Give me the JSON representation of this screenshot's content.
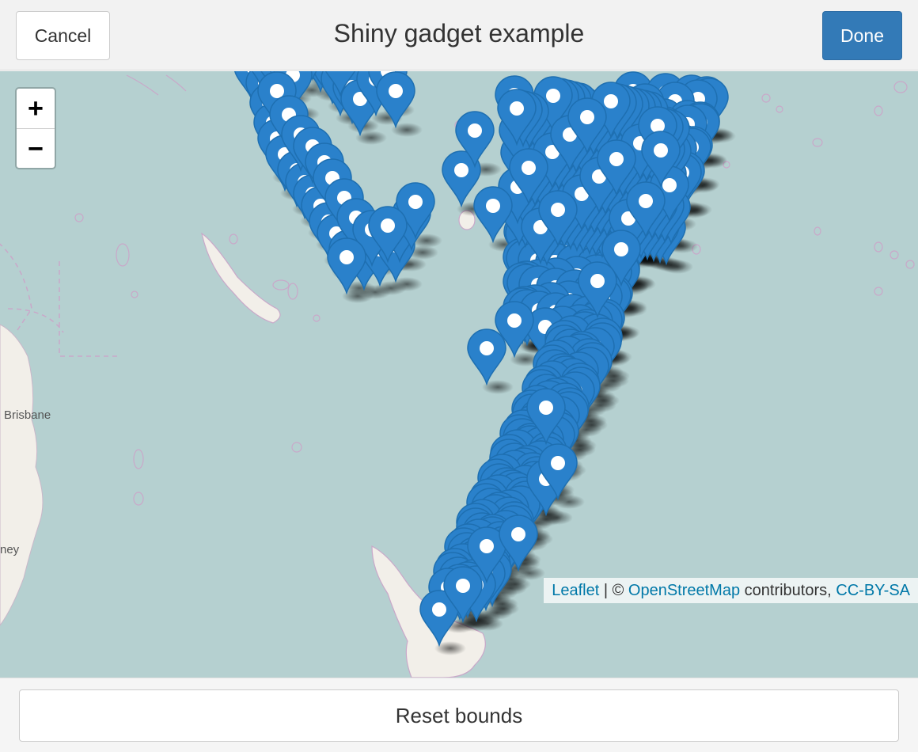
{
  "header": {
    "cancel_label": "Cancel",
    "title": "Shiny gadget example",
    "done_label": "Done"
  },
  "map": {
    "zoom_in_label": "+",
    "zoom_out_label": "−",
    "places": [
      {
        "name": "Brisbane"
      },
      {
        "name": "ney"
      }
    ],
    "attribution": {
      "leaflet": "Leaflet",
      "sep": " | © ",
      "osm": "OpenStreetMap",
      "contributors": " contributors, ",
      "license": "CC-BY-SA"
    },
    "colors": {
      "sea": "#b5d0d0",
      "land": "#f2efe9",
      "marker": "#2a81cb"
    }
  },
  "footer": {
    "reset_label": "Reset bounds"
  }
}
